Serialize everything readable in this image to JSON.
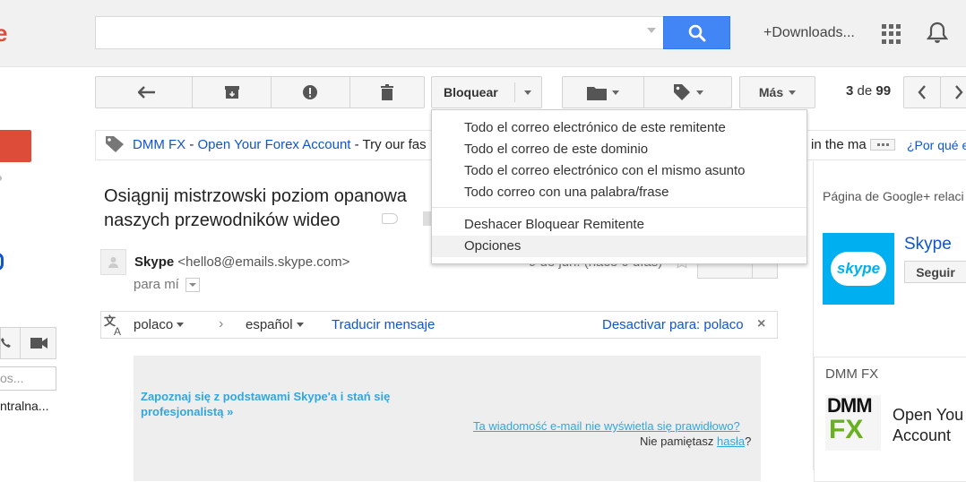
{
  "header": {
    "search_value": "",
    "downloads_label": "+Downloads..."
  },
  "toolbar": {
    "bloquear_label": "Bloquear",
    "mas_label": "Más",
    "counter_current": "3",
    "counter_sep": " de ",
    "counter_total": "99"
  },
  "bloquear_menu": {
    "items": [
      "Todo el correo electrónico de este remitente",
      "Todo el correo de este dominio",
      "Todo el correo electrónico con el mismo asunto",
      "Todo correo con una palabra/frase",
      "Deshacer Bloquear Remitente",
      "Opciones"
    ]
  },
  "ad": {
    "sponsor": "DMM FX",
    "dash": " - ",
    "link": "Open Your Forex Account",
    "tail": " - Try our fas",
    "right_fragment": "in the ma",
    "why_link": "¿Por qué e"
  },
  "message": {
    "subject": "Osiągnij mistrzowski poziom opanowa naszych przewodników wideo",
    "sender_name": "Skype",
    "sender_email": "<hello8@emails.skype.com>",
    "recipient": "para mí",
    "date": "9 de jun. (hace 0 días)"
  },
  "translate": {
    "source_lang": "polaco",
    "target_lang": "español",
    "translate_link": "Traducir mensaje",
    "disable_link": "Desactivar para: polaco"
  },
  "email_body": {
    "headline": "Zapoznaj się z podstawami Skype'a i stań się profesjonalistą »",
    "display_issue": "Ta wiadomość e-mail nie wyświetla się prawidłowo?",
    "forgot_prefix": "Nie pamiętasz ",
    "forgot_link": "hasła",
    "forgot_suffix": "?"
  },
  "right_panel": {
    "gplus_title": "Página de Google+ relaci",
    "skype_name": "Skype",
    "skype_logo_text": "skype",
    "follow_label": "Seguir",
    "ad_title": "DMM FX",
    "ad_logo_top": "DMM",
    "ad_logo_bottom": "FX",
    "ad_text_line1": "Open You",
    "ad_text_line2": "Account"
  },
  "left_panel": {
    "search_placeholder": "os...",
    "contact_name": "ntralna..."
  },
  "colors": {
    "accent_blue": "#4285f4",
    "link_blue": "#15c",
    "skype_blue": "#00aff0",
    "compose_red": "#dd4b39"
  }
}
